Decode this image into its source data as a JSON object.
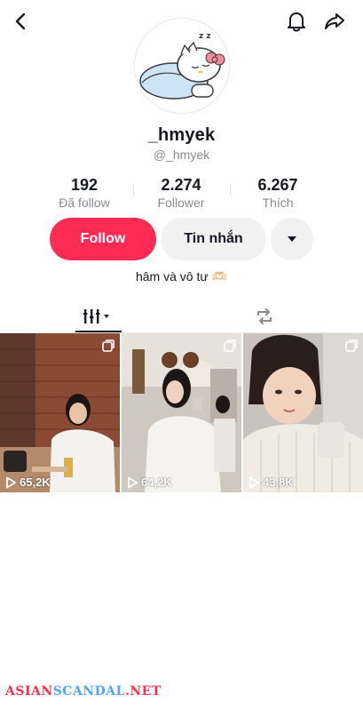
{
  "header": {
    "back_icon": "back-chevron-icon",
    "bell_icon": "bell-icon",
    "share_icon": "share-arrow-icon"
  },
  "profile": {
    "display_name": "_hmyek",
    "username": "@_hmyek",
    "avatar_icon": "sleeping-cartoon-cat-avatar",
    "avatar_text": "z z"
  },
  "stats": [
    {
      "value": "192",
      "label": "Đã follow"
    },
    {
      "value": "2.274",
      "label": "Follower"
    },
    {
      "value": "6.267",
      "label": "Thích"
    }
  ],
  "actions": {
    "follow_label": "Follow",
    "message_label": "Tin nhắn",
    "more_icon": "caret-down-icon"
  },
  "bio": "hâm và vô tư 🫶🏻",
  "tabs": [
    {
      "name": "videos",
      "icon": "grid-bars-icon",
      "active": true
    },
    {
      "name": "reposts",
      "icon": "repost-icon",
      "active": false
    }
  ],
  "videos": [
    {
      "views": "65,2K",
      "multi_icon": "photo-stack-icon"
    },
    {
      "views": "64,2K",
      "multi_icon": "photo-stack-icon"
    },
    {
      "views": "43,8K",
      "multi_icon": "photo-stack-icon"
    }
  ],
  "watermark": {
    "part1": "ASIAN",
    "part2": "SCANDAL",
    "part3": ".NET"
  },
  "colors": {
    "accent": "#fe2c55",
    "secondary_button": "#f1f1f2",
    "muted_text": "#8a8b91"
  }
}
